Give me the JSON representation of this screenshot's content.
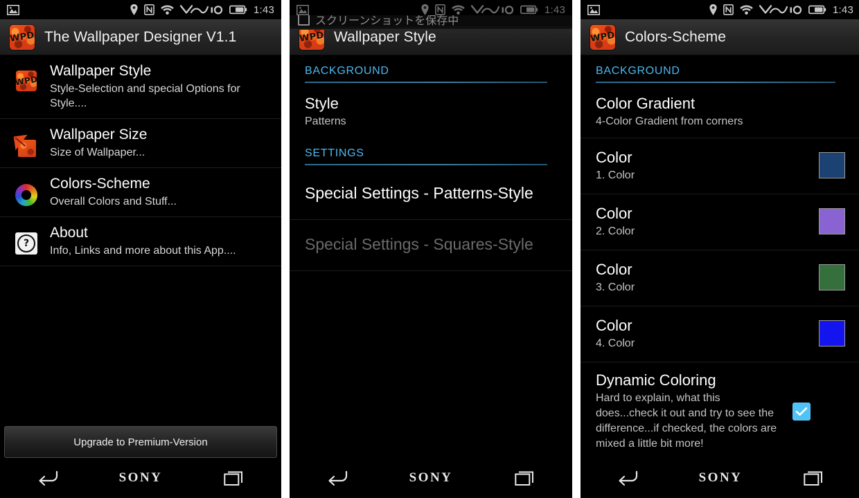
{
  "statusbar": {
    "time": "1:43",
    "icons": [
      "image-icon",
      "location-pin-icon",
      "nfc-icon",
      "wifi-icon",
      "vaio-logo-icon",
      "battery-icon"
    ]
  },
  "navbar": {
    "back_label": "back-icon",
    "brand": "SONY",
    "recents_label": "recents-icon"
  },
  "panel1": {
    "title": "The Wallpaper Designer V1.1",
    "items": [
      {
        "title": "Wallpaper Style",
        "subtitle": "Style-Selection and special Options for Style....",
        "icon": "wpd-logo-icon"
      },
      {
        "title": "Wallpaper Size",
        "subtitle": "Size of Wallpaper...",
        "icon": "folded-paper-icon"
      },
      {
        "title": "Colors-Scheme",
        "subtitle": "Overall Colors and Stuff...",
        "icon": "color-wheel-icon"
      },
      {
        "title": "About",
        "subtitle": "Info, Links and more about this App....",
        "icon": "question-mark-icon"
      }
    ],
    "premium_button": "Upgrade to Premium-Version"
  },
  "panel2": {
    "title": "Wallpaper Style",
    "notification": "スクリーンショットを保存中",
    "categories": [
      {
        "label": "BACKGROUND"
      },
      {
        "label": "SETTINGS"
      }
    ],
    "rows": [
      {
        "title": "Style",
        "subtitle": "Patterns",
        "enabled": true
      },
      {
        "title": "Special Settings - Patterns-Style",
        "subtitle": "",
        "enabled": true
      },
      {
        "title": "Special Settings - Squares-Style",
        "subtitle": "",
        "enabled": false
      }
    ]
  },
  "panel3": {
    "title": "Colors-Scheme",
    "category": "BACKGROUND",
    "gradient": {
      "title": "Color Gradient",
      "subtitle": "4-Color Gradient from corners"
    },
    "colors": [
      {
        "title": "Color",
        "subtitle": "1. Color",
        "hex": "#1b4273"
      },
      {
        "title": "Color",
        "subtitle": "2. Color",
        "hex": "#8a63d2"
      },
      {
        "title": "Color",
        "subtitle": "3. Color",
        "hex": "#35703c"
      },
      {
        "title": "Color",
        "subtitle": "4. Color",
        "hex": "#1414ef"
      }
    ],
    "dynamic": {
      "title": "Dynamic Coloring",
      "subtitle": "Hard to explain, what this does...check it out and try to see the difference...if checked, the colors are mixed a little bit more!",
      "checked": true,
      "checkbox_color": "#4fc3f7"
    }
  },
  "theme": {
    "accent_blue": "#4cbaf0",
    "background": "#000000",
    "actionbar": "#242424"
  }
}
